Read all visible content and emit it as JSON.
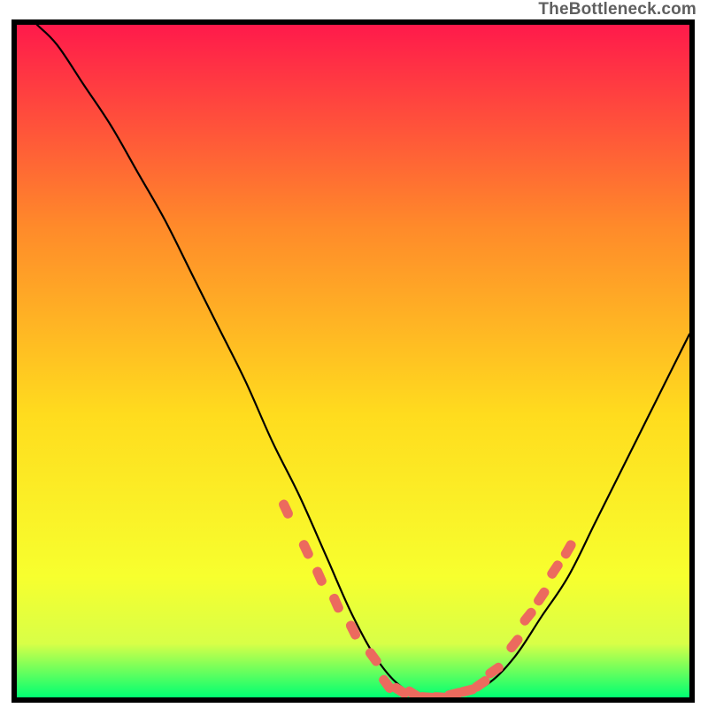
{
  "attribution": "TheBottleneck.com",
  "chart_data": {
    "type": "line",
    "title": "",
    "xlabel": "",
    "ylabel": "",
    "xlim": [
      0,
      100
    ],
    "ylim": [
      0,
      100
    ],
    "grid": false,
    "legend": false,
    "background_gradient": {
      "top_color": "#ff1a4b",
      "mid_upper_color": "#ff8a2a",
      "mid_color": "#ffdc1e",
      "mid_lower_color": "#f7ff2e",
      "bottom_color": "#00ff72",
      "bottom_band_start_pct": 85
    },
    "series": [
      {
        "name": "curve",
        "stroke": "#000000",
        "stroke_width": 2.2,
        "x": [
          3,
          6,
          10,
          14,
          18,
          22,
          26,
          30,
          34,
          38,
          42,
          46,
          50,
          54,
          58,
          62,
          66,
          70,
          74,
          78,
          82,
          86,
          90,
          94,
          98,
          100
        ],
        "values": [
          100,
          97,
          91,
          85,
          78,
          71,
          63,
          55,
          47,
          38,
          30,
          21,
          12,
          5,
          1,
          0,
          0.5,
          2,
          6,
          12,
          18,
          26,
          34,
          42,
          50,
          54
        ]
      },
      {
        "name": "highlight-left",
        "type": "scatter",
        "marker": "rounded-rect",
        "color": "#ec6a5e",
        "x": [
          40,
          43,
          45,
          47.5,
          50,
          53
        ],
        "values": [
          28,
          22,
          18,
          14,
          10,
          6
        ]
      },
      {
        "name": "highlight-bottom",
        "type": "scatter",
        "marker": "rounded-rect",
        "color": "#ec6a5e",
        "x": [
          55,
          57,
          59,
          61,
          63,
          65,
          67,
          69,
          71
        ],
        "values": [
          2,
          1,
          0.5,
          0,
          0,
          0.5,
          1,
          2,
          4
        ]
      },
      {
        "name": "highlight-right",
        "type": "scatter",
        "marker": "rounded-rect",
        "color": "#ec6a5e",
        "x": [
          74,
          76,
          78,
          80,
          82
        ],
        "values": [
          8,
          12,
          15,
          19,
          22
        ]
      }
    ]
  }
}
